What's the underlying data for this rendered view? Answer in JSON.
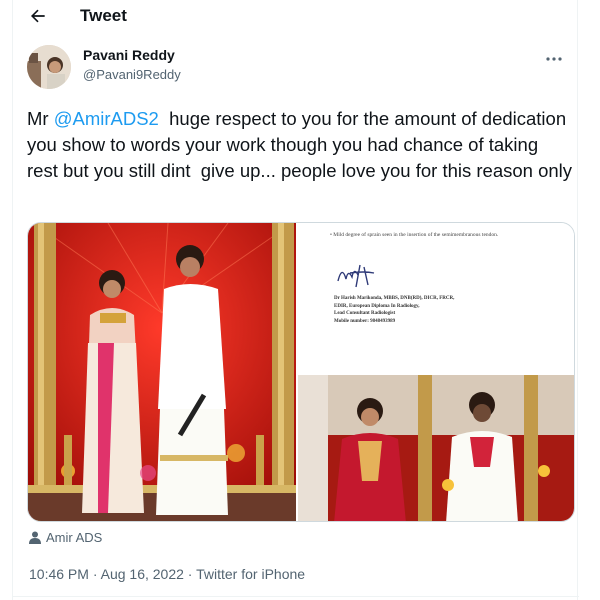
{
  "header": {
    "title": "Tweet",
    "back_icon": "arrow-left-icon"
  },
  "author": {
    "name": "Pavani Reddy",
    "handle": "@Pavani9Reddy",
    "more_icon": "more-horizontal-icon"
  },
  "tweet": {
    "text_prefix": "Mr ",
    "mention": "@AmirADS2",
    "text_suffix": "  huge respect to you for the amount of dedication you show to words your work though you had chance of taking rest but you still dint  give up... people love you for this reason only"
  },
  "media": {
    "document": {
      "bullet_text": "•   Mild degree of sprain seen in the insertion of the semimembranous tendon.",
      "details": [
        "Dr Harish Marikonda, MBBS, DNB(RD), DICR, FRCR,",
        "EDIR, European Diploma In Radiology,",
        "Lead Consultant Radiologist",
        "Mobile number: 9848493989"
      ]
    }
  },
  "attribution": {
    "icon": "person-icon",
    "label": "Amir ADS"
  },
  "meta": {
    "time": "10:46 PM",
    "separator": " · ",
    "date": "Aug 16, 2022",
    "source": "Twitter for iPhone"
  },
  "colors": {
    "accent": "#1d9bf0",
    "secondary_text": "#536471",
    "text": "#0f1419"
  }
}
